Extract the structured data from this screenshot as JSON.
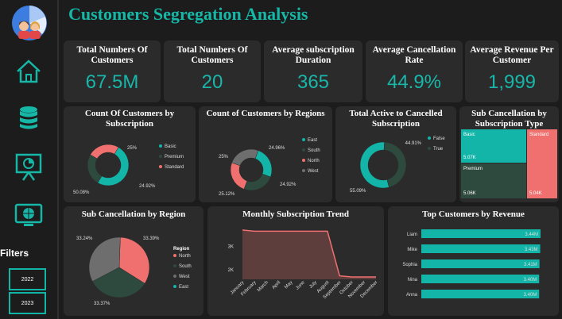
{
  "title": "Customers Segregation Analysis",
  "sidebar": {
    "icons": [
      "home-icon",
      "database-icon",
      "presentation-chart-icon",
      "monitor-icon"
    ],
    "filters_label": "Filters",
    "filters": [
      "2022",
      "2023"
    ]
  },
  "kpis": [
    {
      "label": "Total Numbers Of Customers",
      "value": "67.5M"
    },
    {
      "label": "Total Numbers Of Customers",
      "value": "20"
    },
    {
      "label": "Average subscription Duration",
      "value": "365"
    },
    {
      "label": "Average Cancellation Rate",
      "value": "44.9%"
    },
    {
      "label": "Average Revenue Per Customer",
      "value": "1,999"
    }
  ],
  "colors": {
    "teal": "#12b5a8",
    "dark_green": "#2e4a3e",
    "coral": "#f07070",
    "gray": "#6e6e6e",
    "card": "#2b2b2b",
    "background": "#1c1c1c"
  },
  "chart_data": [
    {
      "type": "pie",
      "title": "Count Of Customers by Subscription",
      "donut": true,
      "slices": [
        {
          "name": "Basic",
          "value": 50.08,
          "label": "50.08%",
          "color": "#12b5a8"
        },
        {
          "name": "Premium",
          "value": 25.0,
          "label": "25%",
          "color": "#2e4a3e"
        },
        {
          "name": "Standard",
          "value": 24.92,
          "label": "24.92%",
          "color": "#f07070"
        }
      ],
      "legend": [
        "Basic",
        "Premium",
        "Standard"
      ]
    },
    {
      "type": "pie",
      "title": "Count of Customers by Regions",
      "donut": true,
      "slices": [
        {
          "name": "East",
          "value": 25.12,
          "label": "25.12%",
          "color": "#12b5a8"
        },
        {
          "name": "South",
          "value": 25.0,
          "label": "25%",
          "color": "#2e4a3e"
        },
        {
          "name": "North",
          "value": 24.96,
          "label": "24.96%",
          "color": "#f07070"
        },
        {
          "name": "West",
          "value": 24.92,
          "label": "24.92%",
          "color": "#6e6e6e"
        }
      ],
      "legend": [
        "East",
        "South",
        "North",
        "West"
      ]
    },
    {
      "type": "pie",
      "title": "Total Active to Cancelled Subscription",
      "donut": true,
      "slices": [
        {
          "name": "False",
          "value": 55.09,
          "label": "55.09%",
          "color": "#12b5a8"
        },
        {
          "name": "True",
          "value": 44.91,
          "label": "44.91%",
          "color": "#2e4a3e"
        }
      ],
      "legend": [
        "False",
        "True"
      ]
    },
    {
      "type": "treemap",
      "title": "Sub Cancellation by Subscription Type",
      "items": [
        {
          "name": "Basic",
          "value": "5.07K",
          "color": "#12b5a8"
        },
        {
          "name": "Premium",
          "value": "5.06K",
          "color": "#2e4a3e"
        },
        {
          "name": "Standard",
          "value": "5.04K",
          "color": "#f07070"
        }
      ]
    },
    {
      "type": "pie",
      "title": "Sub Cancellation by Region",
      "donut": false,
      "legend_title": "Region",
      "slices": [
        {
          "name": "North",
          "value": 33.39,
          "label": "33.39%",
          "color": "#f07070"
        },
        {
          "name": "South",
          "value": 33.37,
          "label": "33.37%",
          "color": "#2e4a3e"
        },
        {
          "name": "West",
          "value": 33.24,
          "label": "33.24%",
          "color": "#6e6e6e"
        },
        {
          "name": "East",
          "value": 0.0,
          "label": "",
          "color": "#12b5a8"
        }
      ],
      "legend": [
        "North",
        "South",
        "West",
        "East"
      ]
    },
    {
      "type": "area",
      "title": "Monthly Subscription Trend",
      "categories": [
        "January",
        "February",
        "March",
        "April",
        "May",
        "June",
        "July",
        "August",
        "September",
        "October",
        "November",
        "December"
      ],
      "values": [
        3700,
        3650,
        3650,
        3650,
        3650,
        3650,
        3650,
        3650,
        1750,
        1700,
        1700,
        1700
      ],
      "ticks": [
        "2K",
        "3K"
      ],
      "ylim": [
        1600,
        3900
      ]
    },
    {
      "type": "bar",
      "orientation": "horizontal",
      "title": "Top Customers by Revenue",
      "categories": [
        "Liam",
        "Mike",
        "Sophia",
        "Nina",
        "Anna"
      ],
      "values": [
        3.44,
        3.43,
        3.41,
        3.4,
        3.4
      ],
      "labels": [
        "3.44M",
        "3.43M",
        "3.41M",
        "3.40M",
        "3.40M"
      ],
      "xlim": [
        0,
        3.44
      ]
    }
  ]
}
